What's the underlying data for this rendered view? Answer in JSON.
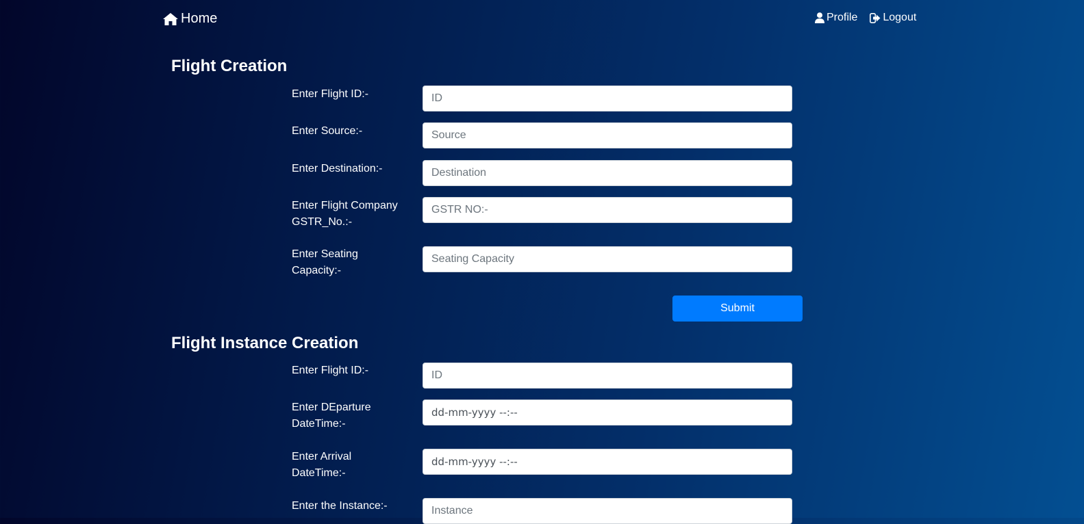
{
  "nav": {
    "home_label": "Home",
    "profile_label": "Profile",
    "logout_label": "Logout"
  },
  "flight_creation": {
    "title": "Flight Creation",
    "fields": [
      {
        "label": "Enter Flight ID:-",
        "placeholder": "ID"
      },
      {
        "label": "Enter Source:-",
        "placeholder": "Source"
      },
      {
        "label": "Enter Destination:-",
        "placeholder": "Destination"
      },
      {
        "label_line1": "Enter Flight Company",
        "label_line2": "GSTR_No.:-",
        "placeholder": "GSTR NO:-"
      },
      {
        "label_line1": "Enter Seating",
        "label_line2": "Capacity:-",
        "placeholder": "Seating Capacity"
      }
    ],
    "submit_label": "Submit"
  },
  "flight_instance_creation": {
    "title": "Flight Instance Creation",
    "fields": [
      {
        "label": "Enter Flight ID:-",
        "placeholder": "ID"
      },
      {
        "label_line1": "Enter DEparture",
        "label_line2": "DateTime:-",
        "value": "dd-mm-yyyy --:--"
      },
      {
        "label_line1": "Enter Arrival",
        "label_line2": "DateTime:-",
        "value": "dd-mm-yyyy --:--"
      },
      {
        "label": "Enter the Instance:-",
        "placeholder": "Instance"
      }
    ]
  },
  "icons": {
    "home": "home-icon",
    "profile": "user-icon",
    "logout": "sign-out-icon"
  }
}
